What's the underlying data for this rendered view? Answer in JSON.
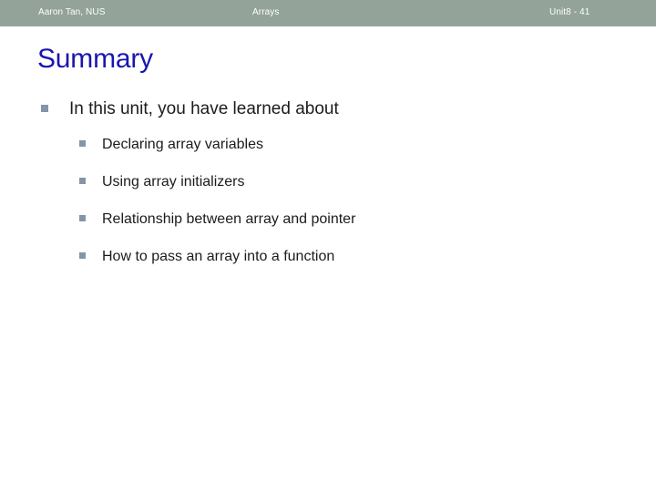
{
  "header": {
    "left": "Aaron Tan, NUS",
    "center": "Arrays",
    "right": "Unit8 - 41",
    "background_color": "#93a399",
    "text_color": "#ffffff"
  },
  "slide": {
    "title": "Summary",
    "title_color": "#1a15b0",
    "bullet_marker_color": "#8595a9",
    "body_text_color": "#1c1c1c",
    "background_color": "#ffffff",
    "main_bullet": {
      "text": "In this unit, you have learned about",
      "marker": "square-bullet"
    },
    "sub_bullets": [
      {
        "text": "Declaring array variables",
        "marker": "square-bullet"
      },
      {
        "text": "Using array initializers",
        "marker": "square-bullet"
      },
      {
        "text": "Relationship between array and pointer",
        "marker": "square-bullet"
      },
      {
        "text": "How to pass an array into a function",
        "marker": "square-bullet"
      }
    ]
  }
}
